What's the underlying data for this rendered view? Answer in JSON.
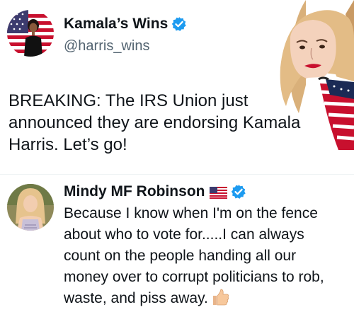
{
  "main_tweet": {
    "display_name": "Kamala’s Wins",
    "handle": "@harris_wins",
    "text": "BREAKING: The IRS Union just announced they are endorsing Kamala Harris. Let’s go!"
  },
  "reply": {
    "display_name": "Mindy MF Robinson",
    "text": "Because I know when I'm on the fence about who to vote for.....I can always count on the people handing all our money over to corrupt politicians to rob, waste, and piss away."
  },
  "colors": {
    "verified": "#1d9bf0",
    "text": "#0f1419",
    "secondary_text": "#536471",
    "divider": "#eff3f4"
  },
  "icons": {
    "verified": "verified-badge-icon",
    "flag": "us-flag-emoji",
    "thumb": "thumbs-up-emoji"
  }
}
